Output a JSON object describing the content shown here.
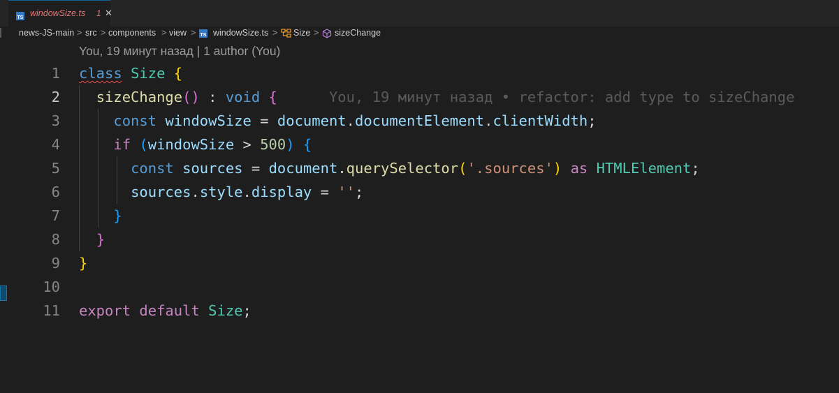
{
  "tab": {
    "filename": "windowSize.ts",
    "problem_count": "1",
    "icon": "typescript-file-icon"
  },
  "breadcrumb": {
    "items": [
      "news-JS-main",
      "src",
      "components",
      "view",
      "windowSize.ts",
      "Size",
      "sizeChange"
    ],
    "separator": ">"
  },
  "codelens": {
    "text": "You, 19 минут назад | 1 author (You)"
  },
  "editor": {
    "active_line": 2,
    "line_numbers": [
      "1",
      "2",
      "3",
      "4",
      "5",
      "6",
      "7",
      "8",
      "9",
      "10",
      "11"
    ],
    "blame": "You, 19 минут назад • refactor: add type to sizeChange",
    "tokens": {
      "l1_class": "class",
      "l1_name": "Size",
      "l1_brace": "{",
      "l2_fn": "sizeChange",
      "l2_parens": "()",
      "l2_colon": " : ",
      "l2_void": "void",
      "l2_brace": "{",
      "l3_const": "const",
      "l3_var": "windowSize",
      "l3_eq": " = ",
      "l3_doc": "document",
      "l3_dot1": ".",
      "l3_docEl": "documentElement",
      "l3_dot2": ".",
      "l3_cw": "clientWidth",
      "l3_semi": ";",
      "l4_if": "if",
      "l4_p_open": "(",
      "l4_var": "windowSize",
      "l4_gt": " > ",
      "l4_num": "500",
      "l4_p_close": ")",
      "l4_brace": "{",
      "l5_const": "const",
      "l5_var": "sources",
      "l5_eq": " = ",
      "l5_doc": "document",
      "l5_dot": ".",
      "l5_qs": "querySelector",
      "l5_p_open": "(",
      "l5_str": "'.sources'",
      "l5_p_close": ")",
      "l5_as": "as",
      "l5_type": "HTMLElement",
      "l5_semi": ";",
      "l6_src": "sources",
      "l6_dot1": ".",
      "l6_style": "style",
      "l6_dot2": ".",
      "l6_disp": "display",
      "l6_eq": " = ",
      "l6_str": "''",
      "l6_semi": ";",
      "l7_brace": "}",
      "l8_brace": "}",
      "l9_brace": "}",
      "l11_export": "export",
      "l11_default": "default",
      "l11_name": "Size",
      "l11_semi": ";"
    }
  }
}
